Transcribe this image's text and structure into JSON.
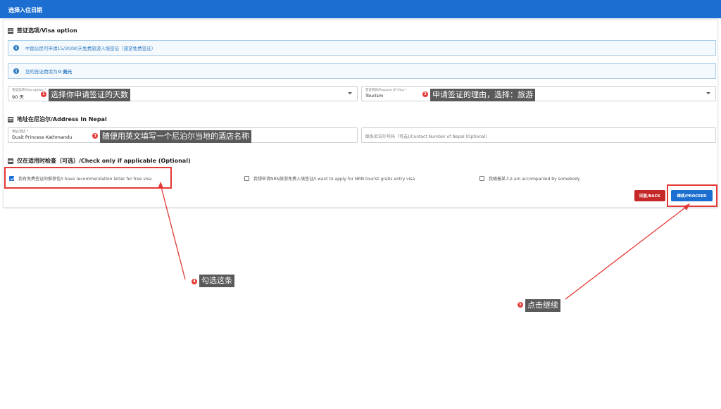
{
  "header": {
    "title": "选择入住日期"
  },
  "visa_section": {
    "title": "签证选项/Visa option",
    "alerts": [
      {
        "text": "中国公民可申请15/30/90天免费旅游入境签证（旅游免费签证）",
        "bold": ""
      },
      {
        "text": "您的签证费用为",
        "bold": "0 美元"
      }
    ],
    "visa_option": {
      "label": "签证选项/Visa option *",
      "value": "90 天"
    },
    "purpose": {
      "label": "签证目的/Purpose Of Visa *",
      "value": "Tourism"
    }
  },
  "address_section": {
    "title": "地址在尼泊尔/Address In Nepal",
    "hotel": {
      "label": "地址/酒店 *",
      "value": "Dusit Princess Kathmandu"
    },
    "contact": {
      "placeholder": "联系尼泊尔号码（可选)/Contact Number of Nepal (Optional)"
    }
  },
  "check_section": {
    "title": "仅在适用时检查（可选）/Check only if applicable (Optional)",
    "options": [
      {
        "label": "我有免费签证的推荐信/I have recommendation letter for free visa",
        "checked": true
      },
      {
        "label": "我想申请NRN旅游免费入境签证/I want to apply for NRN tourist gratis entry visa",
        "checked": false
      },
      {
        "label": "我随着某人/I am accompanied by somebody",
        "checked": false
      }
    ]
  },
  "buttons": {
    "back": "回复/BACK",
    "proceed": "继续/PROCEED"
  },
  "annotations": [
    {
      "num": "1",
      "text": "选择你申请签证的天数"
    },
    {
      "num": "2",
      "text": "申请签证的理由，选择：旅游"
    },
    {
      "num": "3",
      "text": "随便用英文填写一个尼泊尔当地的酒店名称"
    },
    {
      "num": "4",
      "text": "勾选这条"
    },
    {
      "num": "5",
      "text": "点击继续"
    }
  ],
  "colors": {
    "primary": "#1c6fd1",
    "danger": "#c62828",
    "annotation": "#e53935",
    "callout": "#5a5a5a"
  }
}
